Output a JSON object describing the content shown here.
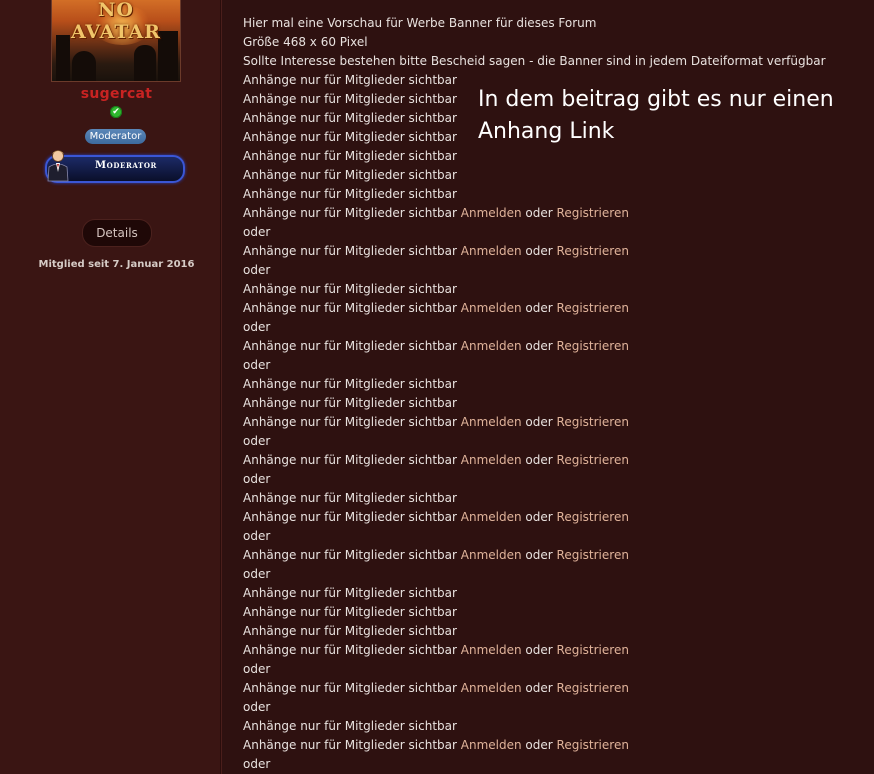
{
  "sidebar": {
    "avatar_text": "NO AVATAR",
    "username": "sugercat",
    "online_status": "✔",
    "group_badge": "Moderator",
    "rank_title": "Moderator",
    "details_label": "Details",
    "member_since": "Mitglied seit 7. Januar 2016"
  },
  "post": {
    "intro": [
      "Hier mal eine Vorschau für Werbe Banner für dieses Forum",
      "Größe 468 x 60 Pixel",
      "Sollte Interesse bestehen bitte Bescheid sagen - die Banner sind in jedem Dateiformat verfügbar"
    ],
    "attachment_text": "Anhänge nur für Mitglieder sichtbar",
    "login_link": "Anmelden",
    "or_text": "oder",
    "register_link": "Registrieren",
    "lines": [
      {
        "kind": "plain"
      },
      {
        "kind": "plain"
      },
      {
        "kind": "plain"
      },
      {
        "kind": "plain"
      },
      {
        "kind": "plain"
      },
      {
        "kind": "plain"
      },
      {
        "kind": "plain"
      },
      {
        "kind": "links"
      },
      {
        "kind": "oder"
      },
      {
        "kind": "links"
      },
      {
        "kind": "oder"
      },
      {
        "kind": "plain"
      },
      {
        "kind": "links"
      },
      {
        "kind": "oder"
      },
      {
        "kind": "links"
      },
      {
        "kind": "oder"
      },
      {
        "kind": "plain"
      },
      {
        "kind": "plain"
      },
      {
        "kind": "links"
      },
      {
        "kind": "oder"
      },
      {
        "kind": "links"
      },
      {
        "kind": "oder"
      },
      {
        "kind": "plain"
      },
      {
        "kind": "links"
      },
      {
        "kind": "oder"
      },
      {
        "kind": "links"
      },
      {
        "kind": "oder"
      },
      {
        "kind": "plain"
      },
      {
        "kind": "plain"
      },
      {
        "kind": "plain"
      },
      {
        "kind": "links"
      },
      {
        "kind": "oder"
      },
      {
        "kind": "links"
      },
      {
        "kind": "oder"
      },
      {
        "kind": "plain"
      },
      {
        "kind": "links"
      },
      {
        "kind": "oder"
      }
    ]
  },
  "annotation": {
    "line1": "In dem beitrag gibt es nur einen",
    "line2": "Anhang Link"
  },
  "colors": {
    "background": "#2e1110",
    "sidebar": "#3a1513",
    "username": "#c82322",
    "link": "#e0b39a",
    "badge": "#3d6a9e"
  }
}
